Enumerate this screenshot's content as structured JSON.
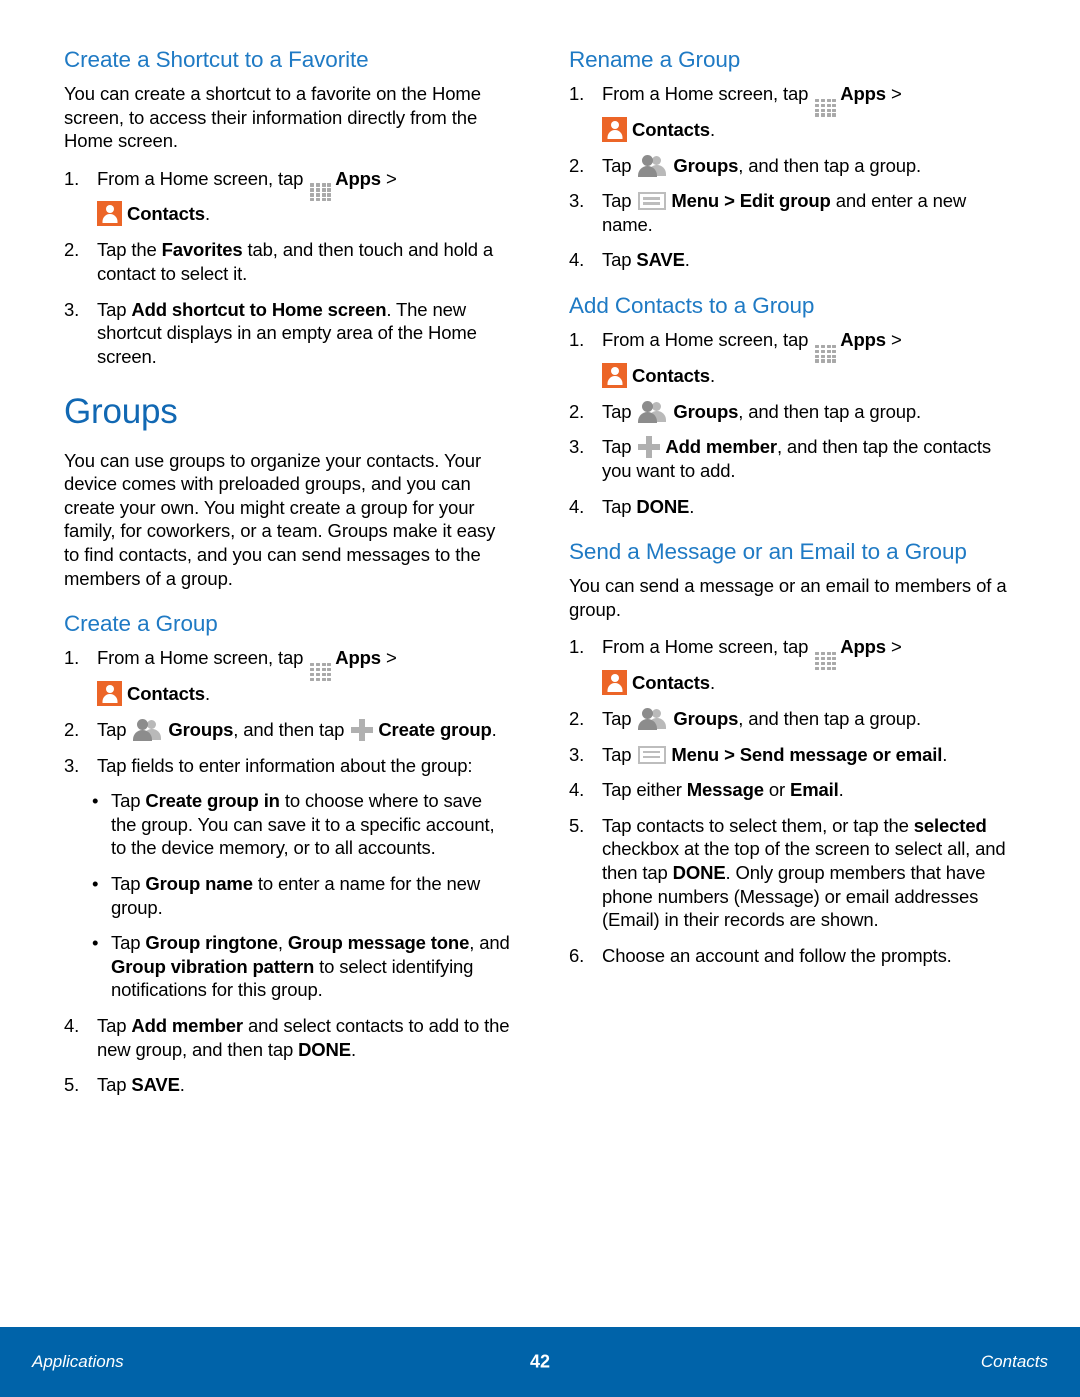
{
  "page": {
    "number": "42",
    "footer_left": "Applications",
    "footer_right": "Contacts",
    "footer_color": "#0063a9",
    "heading_color_h1": "#1168b3",
    "heading_color_h2": "#1f7ac4",
    "contacts_icon_color": "#ec6527"
  },
  "icons": {
    "apps": "apps-grid-icon",
    "contacts": "contacts-person-icon",
    "groups": "groups-two-people-icon",
    "plus": "plus-icon",
    "menu": "menu-icon"
  },
  "left_column": {
    "blocks": [
      {
        "type": "h2",
        "name": "create-a-shortcut-to-a-favorite",
        "text": "Create a Shortcut to a Favorite"
      },
      {
        "type": "p",
        "name": "create-shortcut-intro",
        "segments": [
          {
            "t": "You can create a shortcut to a favorite on the Home screen, to access their information directly from the Home screen."
          }
        ]
      },
      {
        "type": "ol",
        "name": "create-shortcut-steps",
        "items": [
          {
            "num": "1.",
            "segments": [
              {
                "t": "From a Home screen, tap "
              },
              {
                "icon": "apps"
              },
              {
                "t": "Apps",
                "b": true
              },
              {
                "t": " > "
              },
              {
                "br": true
              },
              {
                "icon": "contacts"
              },
              {
                "t": "Contacts",
                "b": true
              },
              {
                "t": "."
              }
            ]
          },
          {
            "num": "2.",
            "segments": [
              {
                "t": "Tap the "
              },
              {
                "t": "Favorites",
                "b": true
              },
              {
                "t": " tab, and then touch and hold a contact to select it."
              }
            ]
          },
          {
            "num": "3.",
            "segments": [
              {
                "t": "Tap "
              },
              {
                "t": "Add shortcut to Home screen",
                "b": true
              },
              {
                "t": ". The new shortcut displays in an empty area of the Home screen."
              }
            ]
          }
        ]
      },
      {
        "type": "h1",
        "name": "groups",
        "text": "Groups"
      },
      {
        "type": "p",
        "name": "groups-intro",
        "segments": [
          {
            "t": "You can use groups to organize your contacts. Your device comes with preloaded groups, and you can create your own. You might create a group for your family, for coworkers, or a team. Groups make it easy to find contacts, and you can send messages to the members of a group."
          }
        ]
      },
      {
        "type": "h2",
        "name": "create-a-group",
        "text": "Create a Group"
      },
      {
        "type": "ol",
        "name": "create-group-steps",
        "items": [
          {
            "num": "1.",
            "segments": [
              {
                "t": "From a Home screen, tap "
              },
              {
                "icon": "apps"
              },
              {
                "t": "Apps",
                "b": true
              },
              {
                "t": " > "
              },
              {
                "br": true
              },
              {
                "icon": "contacts"
              },
              {
                "t": "Contacts",
                "b": true
              },
              {
                "t": "."
              }
            ]
          },
          {
            "num": "2.",
            "segments": [
              {
                "t": "Tap "
              },
              {
                "icon": "groups"
              },
              {
                "t": "Groups",
                "b": true
              },
              {
                "t": ", and then tap "
              },
              {
                "icon": "plus"
              },
              {
                "t": "Create group",
                "b": true
              },
              {
                "t": "."
              }
            ]
          },
          {
            "num": "3.",
            "segments": [
              {
                "t": "Tap fields to enter information about the group:"
              }
            ]
          }
        ]
      },
      {
        "type": "ul",
        "name": "create-group-options",
        "items": [
          {
            "segments": [
              {
                "t": "Tap "
              },
              {
                "t": "Create group in",
                "b": true
              },
              {
                "t": " to choose where to save the group. You can save it to a specific account, to the device memory, or to all accounts."
              }
            ]
          },
          {
            "segments": [
              {
                "t": "Tap "
              },
              {
                "t": "Group name",
                "b": true
              },
              {
                "t": " to enter a name for the new group."
              }
            ]
          },
          {
            "segments": [
              {
                "t": "Tap "
              },
              {
                "t": "Group ringtone",
                "b": true
              },
              {
                "t": ", "
              },
              {
                "t": "Group message tone",
                "b": true
              },
              {
                "t": ", and "
              },
              {
                "t": "Group vibration pattern",
                "b": true
              },
              {
                "t": " to select identifying notifications for this group."
              }
            ]
          }
        ]
      },
      {
        "type": "ol",
        "name": "create-group-steps-continued",
        "start": 4,
        "items": [
          {
            "num": "4.",
            "segments": [
              {
                "t": "Tap "
              },
              {
                "t": "Add member",
                "b": true
              },
              {
                "t": " and select contacts to add to the new group, and then tap "
              },
              {
                "t": "DONE",
                "b": true
              },
              {
                "t": "."
              }
            ]
          },
          {
            "num": "5.",
            "segments": [
              {
                "t": "Tap "
              },
              {
                "t": "SAVE",
                "b": true
              },
              {
                "t": "."
              }
            ]
          }
        ]
      }
    ]
  },
  "right_column": {
    "blocks": [
      {
        "type": "h2",
        "name": "rename-a-group",
        "text": "Rename a Group"
      },
      {
        "type": "ol",
        "name": "rename-group-steps",
        "items": [
          {
            "num": "1.",
            "segments": [
              {
                "t": "From a Home screen, tap "
              },
              {
                "icon": "apps"
              },
              {
                "t": "Apps",
                "b": true
              },
              {
                "t": " > "
              },
              {
                "br": true
              },
              {
                "icon": "contacts"
              },
              {
                "t": "Contacts",
                "b": true
              },
              {
                "t": "."
              }
            ]
          },
          {
            "num": "2.",
            "segments": [
              {
                "t": "Tap "
              },
              {
                "icon": "groups"
              },
              {
                "t": "Groups",
                "b": true
              },
              {
                "t": ", and then tap a group."
              }
            ]
          },
          {
            "num": "3.",
            "segments": [
              {
                "t": "Tap "
              },
              {
                "icon": "menu"
              },
              {
                "t": "Menu > Edit group",
                "b": true
              },
              {
                "t": " and enter a new name."
              }
            ]
          },
          {
            "num": "4.",
            "segments": [
              {
                "t": "Tap "
              },
              {
                "t": "SAVE",
                "b": true
              },
              {
                "t": "."
              }
            ]
          }
        ]
      },
      {
        "type": "h2",
        "name": "add-contacts-to-a-group",
        "text": "Add Contacts to a Group"
      },
      {
        "type": "ol",
        "name": "add-contacts-steps",
        "items": [
          {
            "num": "1.",
            "segments": [
              {
                "t": "From a Home screen, tap "
              },
              {
                "icon": "apps"
              },
              {
                "t": "Apps",
                "b": true
              },
              {
                "t": " > "
              },
              {
                "br": true
              },
              {
                "icon": "contacts"
              },
              {
                "t": "Contacts",
                "b": true
              },
              {
                "t": "."
              }
            ]
          },
          {
            "num": "2.",
            "segments": [
              {
                "t": "Tap "
              },
              {
                "icon": "groups"
              },
              {
                "t": "Groups",
                "b": true
              },
              {
                "t": ", and then tap a group."
              }
            ]
          },
          {
            "num": "3.",
            "segments": [
              {
                "t": "Tap "
              },
              {
                "icon": "plus"
              },
              {
                "t": "Add member",
                "b": true
              },
              {
                "t": ", and then tap the contacts you want to add."
              }
            ]
          },
          {
            "num": "4.",
            "segments": [
              {
                "t": "Tap "
              },
              {
                "t": "DONE",
                "b": true
              },
              {
                "t": "."
              }
            ]
          }
        ]
      },
      {
        "type": "h2",
        "name": "send-a-message-or-an-email-to-a-group",
        "text": "Send a Message or an Email to a Group"
      },
      {
        "type": "p",
        "name": "send-message-intro",
        "segments": [
          {
            "t": "You can send a message or an email to members of a group."
          }
        ]
      },
      {
        "type": "ol",
        "name": "send-message-steps",
        "items": [
          {
            "num": "1.",
            "segments": [
              {
                "t": "From a Home screen, tap "
              },
              {
                "icon": "apps"
              },
              {
                "t": "Apps",
                "b": true
              },
              {
                "t": " > "
              },
              {
                "br": true
              },
              {
                "icon": "contacts"
              },
              {
                "t": "Contacts",
                "b": true
              },
              {
                "t": "."
              }
            ]
          },
          {
            "num": "2.",
            "segments": [
              {
                "t": "Tap "
              },
              {
                "icon": "groups"
              },
              {
                "t": "Groups",
                "b": true
              },
              {
                "t": ", and then tap a group."
              }
            ]
          },
          {
            "num": "3.",
            "segments": [
              {
                "t": "Tap "
              },
              {
                "icon": "menu"
              },
              {
                "t": "Menu > Send message or email",
                "b": true
              },
              {
                "t": "."
              }
            ]
          },
          {
            "num": "4.",
            "segments": [
              {
                "t": "Tap either "
              },
              {
                "t": "Message",
                "b": true
              },
              {
                "t": " or "
              },
              {
                "t": "Email",
                "b": true
              },
              {
                "t": "."
              }
            ]
          },
          {
            "num": "5.",
            "segments": [
              {
                "t": "Tap contacts to select them, or tap the "
              },
              {
                "t": "selected",
                "b": true
              },
              {
                "t": " checkbox at the top of the screen to select all, and then tap "
              },
              {
                "t": "DONE",
                "b": true
              },
              {
                "t": ". Only group members that have phone numbers (Message) or email addresses (Email) in their records are shown."
              }
            ]
          },
          {
            "num": "6.",
            "segments": [
              {
                "t": "Choose an account and follow the prompts."
              }
            ]
          }
        ]
      }
    ]
  }
}
